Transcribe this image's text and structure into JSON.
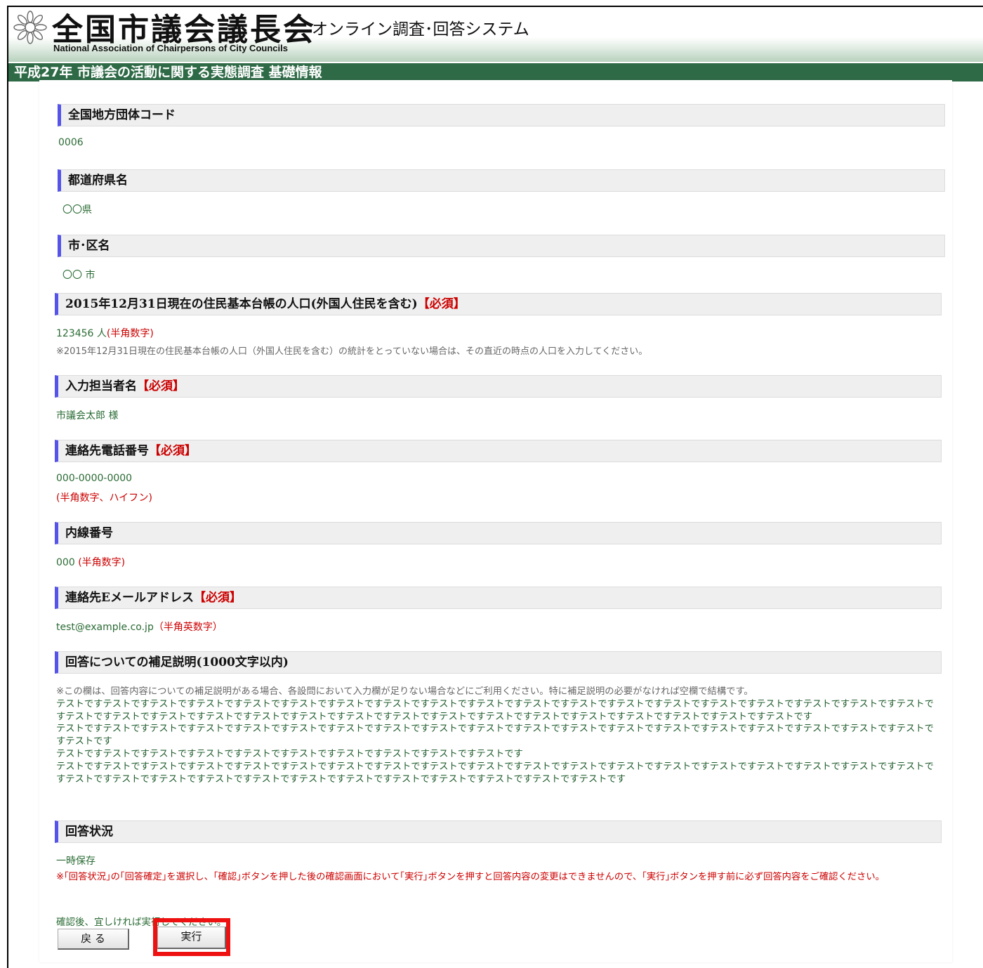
{
  "header": {
    "brand": "全国市議会議長会",
    "system": "オンライン調査･回答システム",
    "english": "National Association of Chairpersons of City Councils"
  },
  "page_title": "平成27年 市議会の活動に関する実態調査 基礎情報",
  "sections": {
    "code": {
      "label": "全国地方団体コード",
      "value": "0006"
    },
    "prefecture": {
      "label": "都道府県名",
      "value": "〇〇県"
    },
    "city": {
      "label": "市･区名",
      "value": "〇〇 市"
    },
    "population": {
      "label": "2015年12月31日現在の住民基本台帳の人口(外国人住民を含む)",
      "required": "【必須】",
      "value": "123456 人",
      "hint": "(半角数字)",
      "note": "※2015年12月31日現在の住民基本台帳の人口（外国人住民を含む）の統計をとっていない場合は、その直近の時点の人口を入力してください。"
    },
    "person": {
      "label": "入力担当者名",
      "required": "【必須】",
      "value": "市議会太郎 様"
    },
    "phone": {
      "label": "連絡先電話番号",
      "required": "【必須】",
      "value": "000-0000-0000",
      "hint": "(半角数字、ハイフン)"
    },
    "extension": {
      "label": "内線番号",
      "value": "000",
      "hint": "(半角数字)"
    },
    "email": {
      "label": "連絡先Eメールアドレス",
      "required": "【必須】",
      "value": "test@example.co.jp",
      "hint": "（半角英数字）"
    },
    "supplement": {
      "label": "回答についての補足説明(1000文字以内)",
      "note": "※この欄は、回答内容についての補足説明がある場合、各設問において入力欄が足りない場合などにご利用ください。特に補足説明の必要がなければ空欄で結構です。",
      "lines": [
        "テストですテストですテストですテストですテストですテストですテストですテストですテストですテストですテストですテストですテストですテストですテストですテストですテストですテストですテストですテストですテストですテストですテストですテストですテストですテストですテストですテストですテストですテストですテストですテストですテストですテストですテストです",
        "テストですテストですテストですテストですテストですテストですテストですテストですテストですテストですテストですテストですテストですテストですテストですテストですテストですテストですテストですテストです",
        "テストですテストですテストですテストですテストですテストですテストですテストですテストですテストです",
        "テストですテストですテストですテストですテストですテストですテストですテストですテストですテストですテストですテストですテストですテストですテストですテストですテストですテストですテストですテストですテストですテストですテストですテストですテストですテストですテストですテストですテストですテストですテストです"
      ]
    },
    "status": {
      "label": "回答状況",
      "value": "一時保存",
      "warning": "※｢回答状況｣の｢回答確定｣を選択し、｢確認｣ボタンを押した後の確認画面において｢実行｣ボタンを押すと回答内容の変更はできませんので、｢実行｣ボタンを押す前に必ず回答内容をご確認ください。"
    }
  },
  "confirm_text": "確認後、宜しければ実行してください。",
  "buttons": {
    "back": "戻 る",
    "execute": "実行"
  },
  "colors": {
    "header_bar": "#2e6a46",
    "section_accent": "#5553ea",
    "required": "#cc0000",
    "highlight": "#ee1111"
  }
}
